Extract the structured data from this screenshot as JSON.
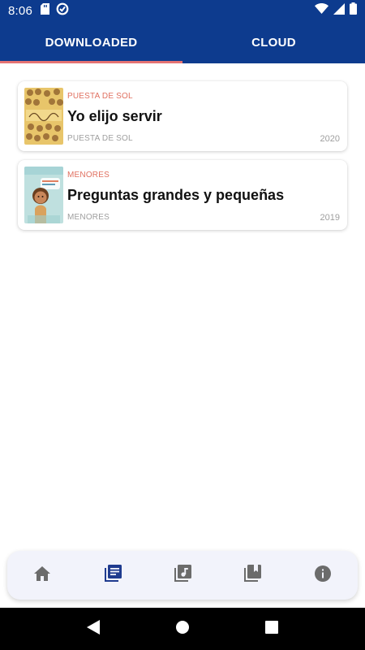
{
  "status": {
    "time": "8:06"
  },
  "tabs": [
    {
      "label": "DOWNLOADED",
      "selected": true
    },
    {
      "label": "CLOUD",
      "selected": false
    }
  ],
  "books": [
    {
      "category": "PUESTA DE SOL",
      "title": "Yo elijo servir",
      "subtitle": "PUESTA DE SOL",
      "year": "2020"
    },
    {
      "category": "MENORES",
      "title": "Preguntas grandes y pequeñas",
      "subtitle": "MENORES",
      "year": "2019"
    }
  ],
  "bottom_nav": {
    "items": [
      {
        "icon": "home-icon",
        "active": false
      },
      {
        "icon": "library-icon",
        "active": true
      },
      {
        "icon": "music-library-icon",
        "active": false
      },
      {
        "icon": "bookmarks-icon",
        "active": false
      },
      {
        "icon": "info-icon",
        "active": false
      }
    ]
  },
  "colors": {
    "primary": "#0d3b8e",
    "accent": "#e57373",
    "category_text": "#e07060",
    "nav_active": "#1f3b8f",
    "nav_inactive": "#6b6b6b"
  }
}
